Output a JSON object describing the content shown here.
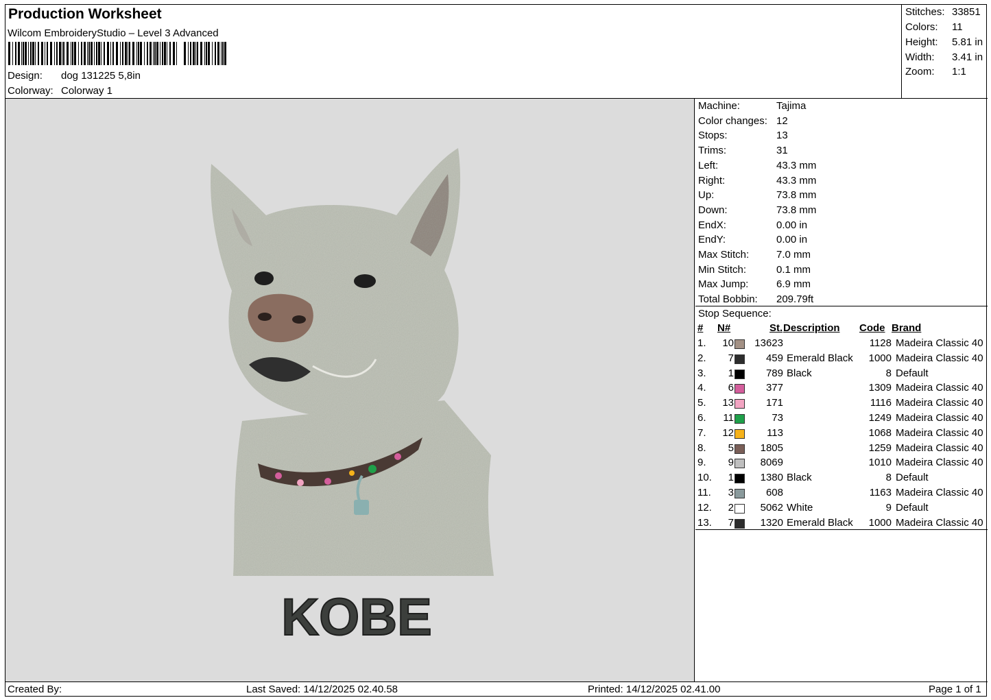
{
  "header": {
    "title": "Production Worksheet",
    "software": "Wilcom EmbroideryStudio – Level 3 Advanced",
    "design_label": "Design:",
    "design_value": "dog  131225 5,8in",
    "colorway_label": "Colorway:",
    "colorway_value": "Colorway 1"
  },
  "stats": {
    "stitches_label": "Stitches:",
    "stitches_value": "33851",
    "colors_label": "Colors:",
    "colors_value": "11",
    "height_label": "Height:",
    "height_value": "5.81 in",
    "width_label": "Width:",
    "width_value": "3.41 in",
    "zoom_label": "Zoom:",
    "zoom_value": "1:1"
  },
  "machine": [
    {
      "label": "Machine:",
      "value": "Tajima"
    },
    {
      "label": "Color changes:",
      "value": "12"
    },
    {
      "label": "Stops:",
      "value": "13"
    },
    {
      "label": "Trims:",
      "value": "31"
    },
    {
      "label": "Left:",
      "value": "43.3 mm"
    },
    {
      "label": "Right:",
      "value": "43.3 mm"
    },
    {
      "label": "Up:",
      "value": "73.8 mm"
    },
    {
      "label": "Down:",
      "value": "73.8 mm"
    },
    {
      "label": "EndX:",
      "value": "0.00 in"
    },
    {
      "label": "EndY:",
      "value": "0.00 in"
    },
    {
      "label": "Max Stitch:",
      "value": "7.0 mm"
    },
    {
      "label": "Min Stitch:",
      "value": "0.1 mm"
    },
    {
      "label": "Max Jump:",
      "value": "6.9 mm"
    },
    {
      "label": "Total Bobbin:",
      "value": "209.79ft"
    }
  ],
  "sequence": {
    "title": "Stop Sequence:",
    "headers": {
      "idx": "#",
      "n": "N#",
      "st": "St.",
      "desc": "Description",
      "code": "Code",
      "brand": "Brand"
    },
    "rows": [
      {
        "idx": "1.",
        "n": "10",
        "color": "#a39185",
        "st": "13623",
        "desc": "",
        "code": "1128",
        "brand": "Madeira Classic 40"
      },
      {
        "idx": "2.",
        "n": "7",
        "color": "#2d2d2d",
        "st": "459",
        "desc": "Emerald Black",
        "code": "1000",
        "brand": "Madeira Classic 40"
      },
      {
        "idx": "3.",
        "n": "1",
        "color": "#000000",
        "st": "789",
        "desc": "Black",
        "code": "8",
        "brand": "Default"
      },
      {
        "idx": "4.",
        "n": "6",
        "color": "#d45e9c",
        "st": "377",
        "desc": "",
        "code": "1309",
        "brand": "Madeira Classic 40"
      },
      {
        "idx": "5.",
        "n": "13",
        "color": "#f2a4c2",
        "st": "171",
        "desc": "",
        "code": "1116",
        "brand": "Madeira Classic 40"
      },
      {
        "idx": "6.",
        "n": "11",
        "color": "#1fa04a",
        "st": "73",
        "desc": "",
        "code": "1249",
        "brand": "Madeira Classic 40"
      },
      {
        "idx": "7.",
        "n": "12",
        "color": "#f6b21a",
        "st": "113",
        "desc": "",
        "code": "1068",
        "brand": "Madeira Classic 40"
      },
      {
        "idx": "8.",
        "n": "5",
        "color": "#7a5f58",
        "st": "1805",
        "desc": "",
        "code": "1259",
        "brand": "Madeira Classic 40"
      },
      {
        "idx": "9.",
        "n": "9",
        "color": "#bfbfbf",
        "st": "8069",
        "desc": "",
        "code": "1010",
        "brand": "Madeira Classic 40"
      },
      {
        "idx": "10.",
        "n": "1",
        "color": "#000000",
        "st": "1380",
        "desc": "Black",
        "code": "8",
        "brand": "Default"
      },
      {
        "idx": "11.",
        "n": "3",
        "color": "#8a9a9c",
        "st": "608",
        "desc": "",
        "code": "1163",
        "brand": "Madeira Classic 40"
      },
      {
        "idx": "12.",
        "n": "2",
        "color": "#ffffff",
        "st": "5062",
        "desc": "White",
        "code": "9",
        "brand": "Default"
      },
      {
        "idx": "13.",
        "n": "7",
        "color": "#2d2d2d",
        "st": "1320",
        "desc": "Emerald Black",
        "code": "1000",
        "brand": "Madeira Classic 40"
      }
    ]
  },
  "preview": {
    "name_text": "KOBE",
    "colors": {
      "background": "#dcdcdc",
      "fur": "#c3c6bb",
      "nose": "#8a6d60",
      "text": "#3c3f3c"
    }
  },
  "footer": {
    "created_by": "Created By:",
    "last_saved": "Last Saved: 14/12/2025 02.40.58",
    "printed": "Printed: 14/12/2025 02.41.00",
    "page": "Page 1 of 1"
  }
}
